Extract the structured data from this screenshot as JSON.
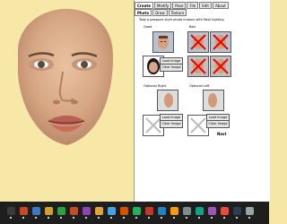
{
  "viewer": {
    "background_color": "#f8e8a7"
  },
  "panel": {
    "tabs": [
      "Create",
      "Modify",
      "Pose",
      "File",
      "Edit",
      "About"
    ],
    "subtabs": [
      "Photo",
      "Draw",
      "Texture"
    ],
    "instruction": "Take a passport-style photo indoors with flash lighting",
    "sections": {
      "good": "Good",
      "bad": "Bad",
      "optional_right": "Optional Right",
      "optional_left": "Optional Left"
    },
    "buttons": {
      "load_image": "Load Image",
      "clear_image": "Clear Image"
    },
    "done": "Next"
  },
  "taskbar": {
    "icons": [
      {
        "name": "start-icon",
        "color": "#3a3a3a"
      },
      {
        "name": "app-icon-1",
        "color": "#c44b2a"
      },
      {
        "name": "app-icon-2",
        "color": "#3a78c2"
      },
      {
        "name": "app-icon-3",
        "color": "#d0a030"
      },
      {
        "name": "app-icon-4",
        "color": "#2f9e44"
      },
      {
        "name": "app-icon-5",
        "color": "#c44b2a"
      },
      {
        "name": "app-icon-6",
        "color": "#8e44ad"
      },
      {
        "name": "app-icon-7",
        "color": "#e2a43a"
      },
      {
        "name": "app-icon-8",
        "color": "#4aa3df"
      },
      {
        "name": "app-icon-9",
        "color": "#d35400"
      },
      {
        "name": "app-icon-10",
        "color": "#27ae60"
      },
      {
        "name": "app-icon-11",
        "color": "#c0392b"
      },
      {
        "name": "app-icon-12",
        "color": "#2980b9"
      },
      {
        "name": "app-icon-13",
        "color": "#f39c12"
      },
      {
        "name": "app-icon-14",
        "color": "#7f8c8d"
      },
      {
        "name": "app-icon-15",
        "color": "#16a085"
      },
      {
        "name": "app-icon-16",
        "color": "#9b59b6"
      },
      {
        "name": "app-icon-17",
        "color": "#e74c3c"
      },
      {
        "name": "app-icon-18",
        "color": "#2c3e50"
      },
      {
        "name": "app-icon-19",
        "color": "#95a5a6"
      }
    ]
  }
}
